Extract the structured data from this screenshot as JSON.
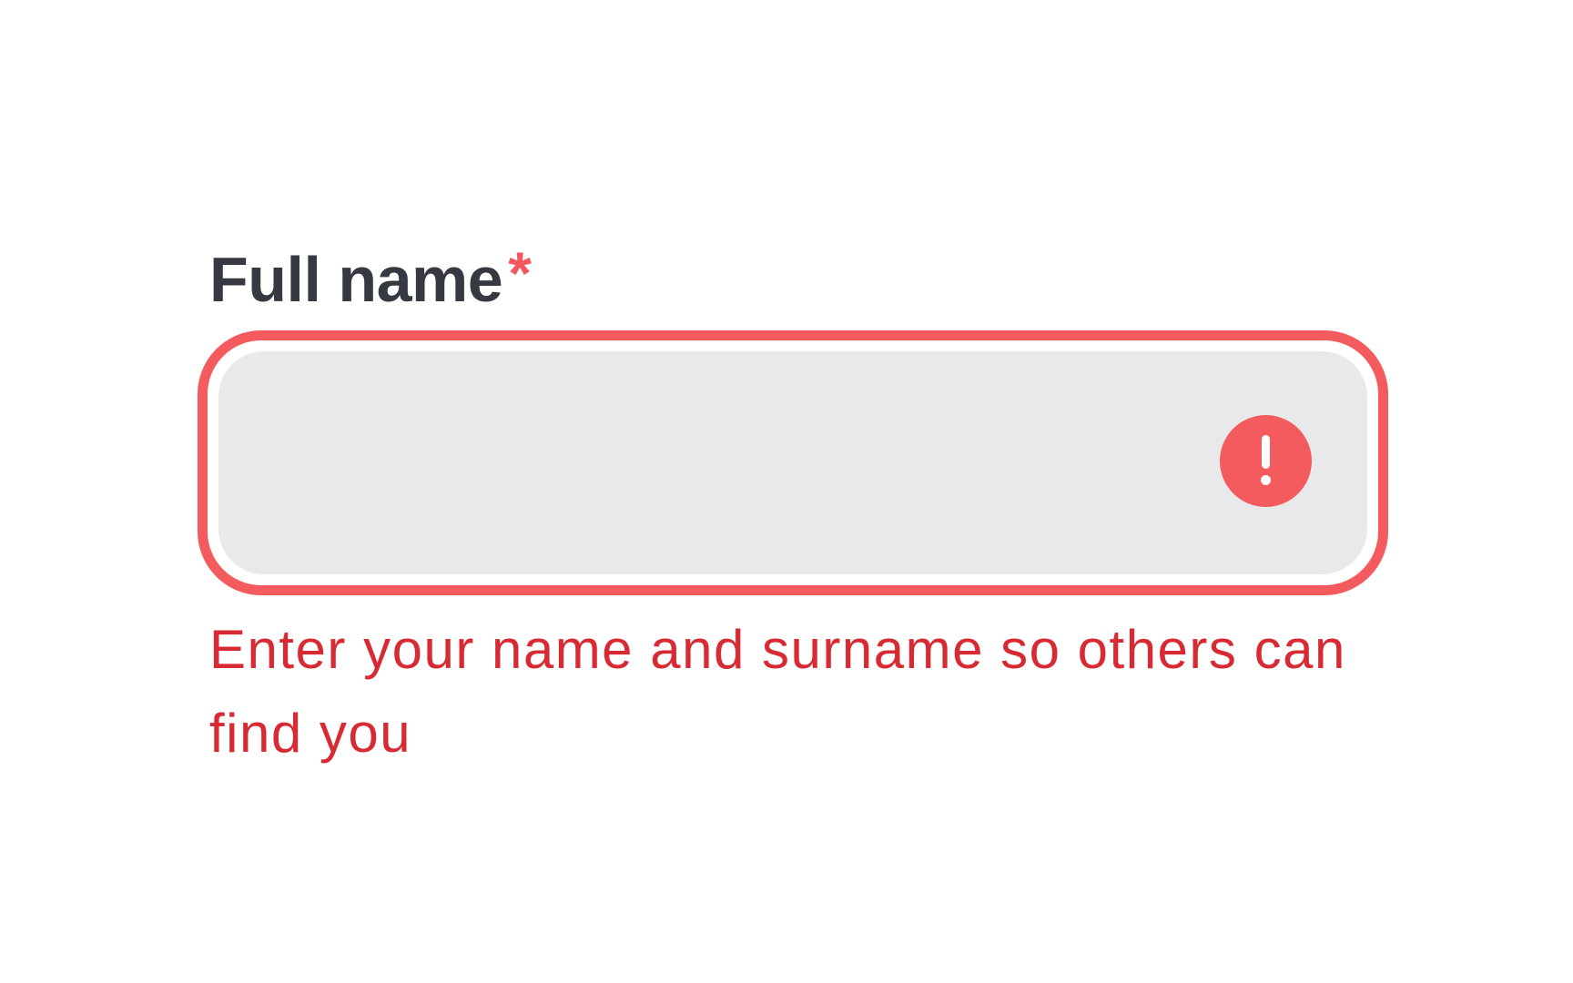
{
  "field": {
    "label": "Full name",
    "required_marker": "*",
    "value": "",
    "placeholder": "",
    "status": "error",
    "helper_text": "Enter your name and surname so others can find you",
    "status_icon": "exclamation-circle-icon"
  },
  "colors": {
    "label": "#363842",
    "error_accent": "#f45b5e",
    "error_text": "#d82a32",
    "input_background": "#e9e9eb"
  }
}
